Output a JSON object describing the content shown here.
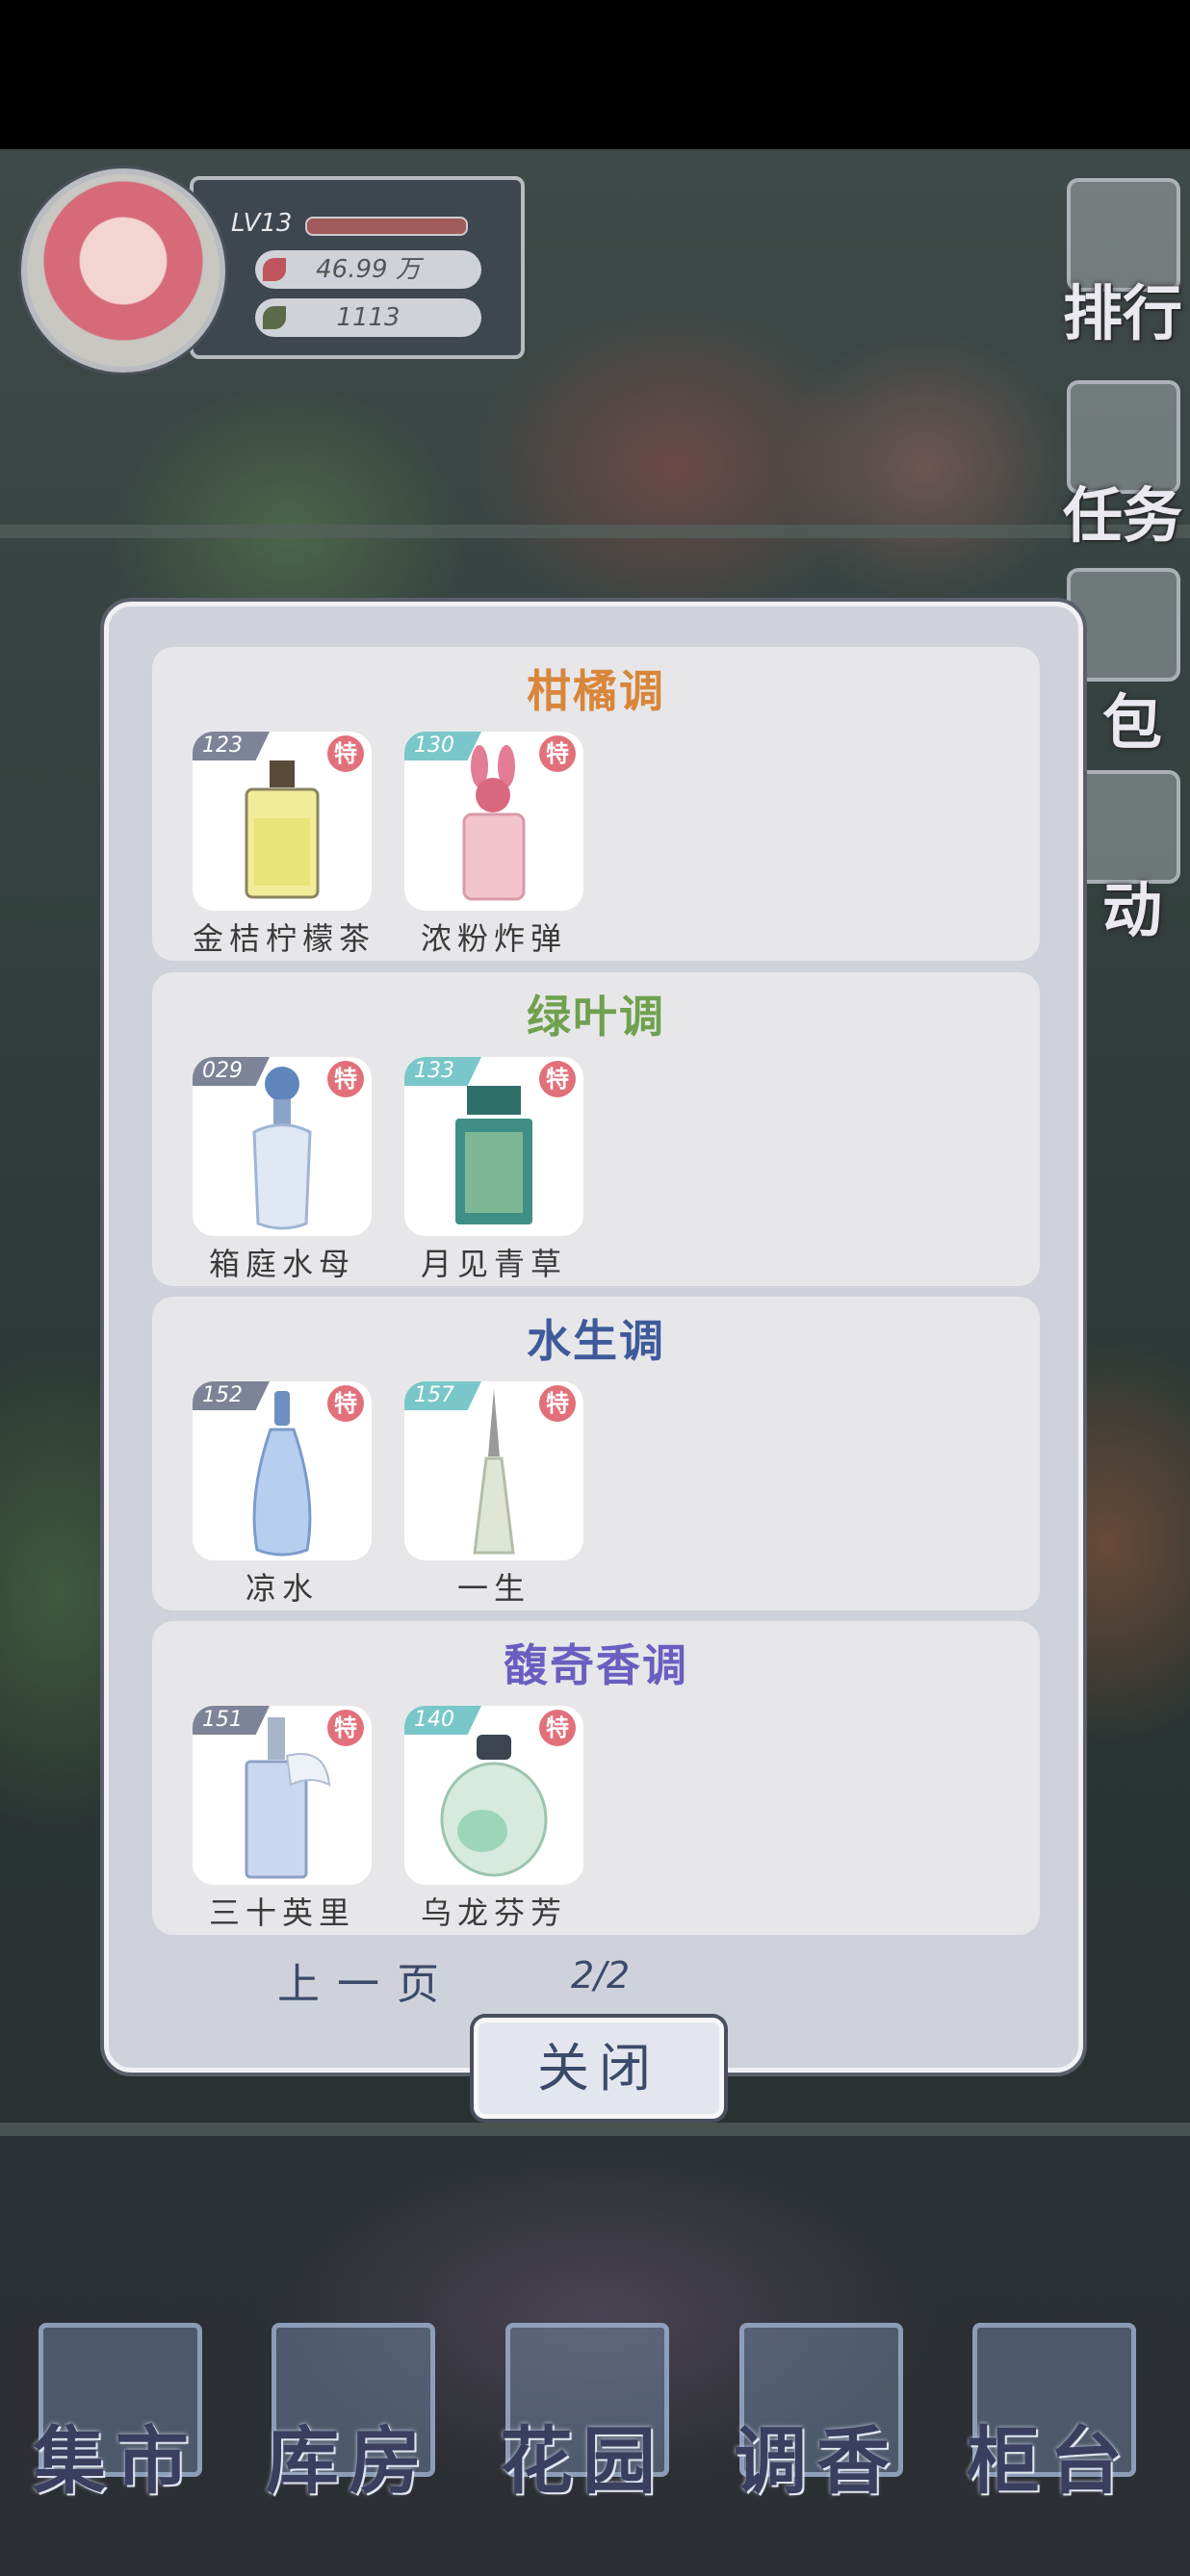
{
  "player": {
    "level": "LV13",
    "coins": "46.99 万",
    "leaves": "1113",
    "colors": {
      "coin": "#c0545c",
      "leaf": "#5b6a48"
    }
  },
  "side_menu": [
    {
      "label": "排行",
      "icon": "ranking-icon"
    },
    {
      "label": "任务",
      "icon": "task-icon"
    },
    {
      "label": "包",
      "icon": "bag-icon"
    },
    {
      "label": "动",
      "icon": "event-icon"
    }
  ],
  "modal": {
    "sections": [
      {
        "title": "柑橘调",
        "title_color": "#d9863a",
        "items": [
          {
            "num": "123",
            "num_color": "#7d8497",
            "special": "特",
            "name": "金桔柠檬茶",
            "icon": "perfume-bottle-yellow-icon"
          },
          {
            "num": "130",
            "num_color": "#79c7c9",
            "special": "特",
            "name": "浓粉炸弹",
            "icon": "perfume-bottle-pink-bunny-icon"
          }
        ]
      },
      {
        "title": "绿叶调",
        "title_color": "#6fa14e",
        "items": [
          {
            "num": "029",
            "num_color": "#7d8497",
            "special": "特",
            "name": "箱庭水母",
            "icon": "perfume-bottle-blue-rose-icon"
          },
          {
            "num": "133",
            "num_color": "#79c7c9",
            "special": "特",
            "name": "月见青草",
            "icon": "perfume-bottle-green-square-icon"
          }
        ]
      },
      {
        "title": "水生调",
        "title_color": "#3e5a9a",
        "items": [
          {
            "num": "152",
            "num_color": "#7d8497",
            "special": "特",
            "name": "凉水",
            "icon": "perfume-bottle-water-icon"
          },
          {
            "num": "157",
            "num_color": "#79c7c9",
            "special": "特",
            "name": "一生",
            "icon": "perfume-bottle-cone-icon"
          }
        ]
      },
      {
        "title": "馥奇香调",
        "title_color": "#6a5fc0",
        "items": [
          {
            "num": "151",
            "num_color": "#7d8497",
            "special": "特",
            "name": "三十英里",
            "icon": "perfume-bottle-crystal-icon"
          },
          {
            "num": "140",
            "num_color": "#79c7c9",
            "special": "特",
            "name": "乌龙芬芳",
            "icon": "perfume-bottle-round-icon"
          }
        ]
      }
    ],
    "prev_page": "上一页",
    "page": "2/2",
    "close": "关闭"
  },
  "bottom_nav": [
    {
      "label": "集市",
      "icon": "market-icon"
    },
    {
      "label": "库房",
      "icon": "warehouse-icon"
    },
    {
      "label": "花园",
      "icon": "garden-icon"
    },
    {
      "label": "调香",
      "icon": "perfume-mixing-icon"
    },
    {
      "label": "柜台",
      "icon": "counter-icon"
    }
  ]
}
